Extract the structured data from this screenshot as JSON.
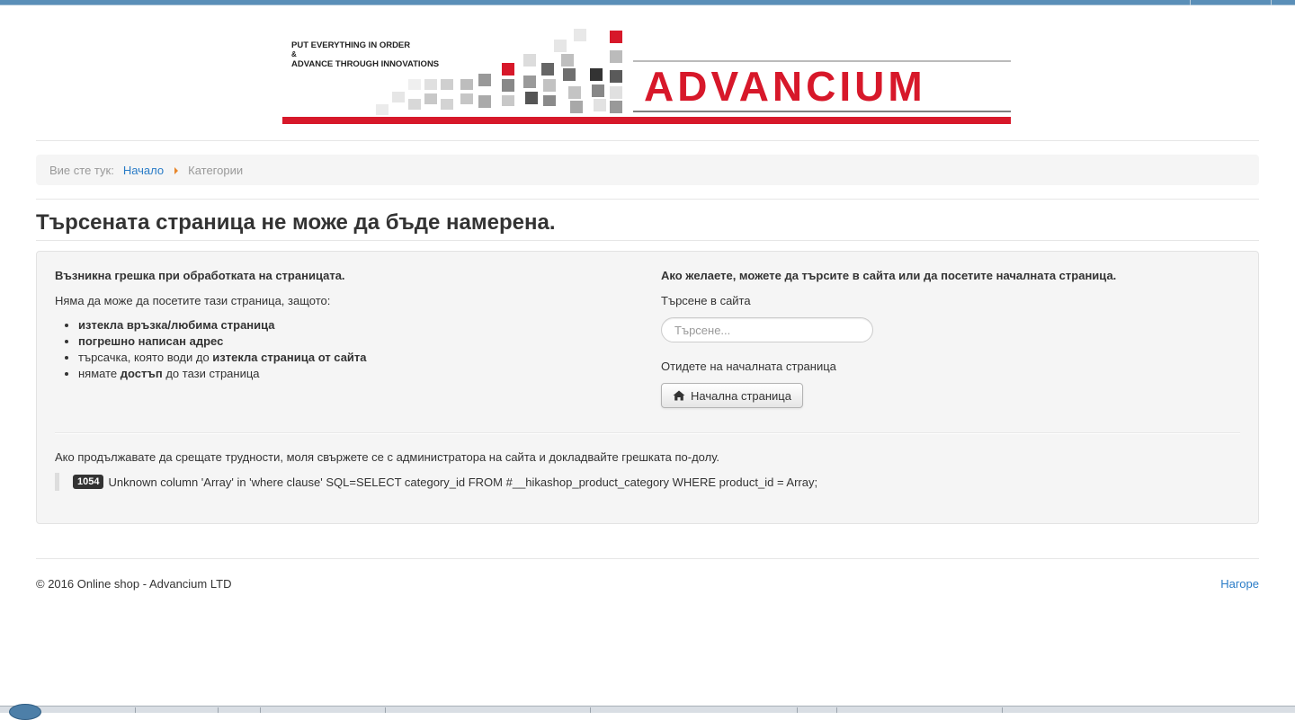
{
  "header": {
    "logo": {
      "tagline_line1": "PUT EVERYTHING IN ORDER",
      "tagline_line2": "&",
      "tagline_line3": "ADVANCE THROUGH INNOVATIONS",
      "brand": "ADVANCIUM",
      "colors": {
        "brand_red": "#d7182a",
        "dark_gray": "#555555"
      }
    }
  },
  "breadcrumb": {
    "prefix": "Вие сте тук:",
    "items": [
      {
        "label": "Начало",
        "link": true
      },
      {
        "label": "Категории",
        "link": false
      }
    ]
  },
  "page_title": "Търсената страница не може да бъде намерена.",
  "error_panel": {
    "left": {
      "heading": "Възникна грешка при обработката на страницата.",
      "intro": "Няма да може да посетите тази страница, защото:",
      "reasons": [
        {
          "parts": [
            {
              "text": "изтекла връзка/любима страница",
              "bold": true
            }
          ]
        },
        {
          "parts": [
            {
              "text": "погрешно написан адрес",
              "bold": true
            }
          ]
        },
        {
          "parts": [
            {
              "text": "търсачка, която води до ",
              "bold": false
            },
            {
              "text": "изтекла страница от сайта",
              "bold": true
            }
          ]
        },
        {
          "parts": [
            {
              "text": "нямате ",
              "bold": false
            },
            {
              "text": "достъп",
              "bold": true
            },
            {
              "text": " до тази страница",
              "bold": false
            }
          ]
        }
      ]
    },
    "right": {
      "heading": "Ако желаете, можете да търсите в сайта или да посетите началната страница.",
      "search_label": "Търсене в сайта",
      "search_placeholder": "Търсене...",
      "search_value": "",
      "home_label": "Отидете на началната страница",
      "home_button": "Начална страница"
    },
    "help_text": "Ако продължавате да срещате трудности, моля свържете се с администратора на сайта и докладвайте грешката по-долу.",
    "error_code": "1054",
    "error_message": "Unknown column 'Array' in 'where clause' SQL=SELECT category_id FROM #__hikashop_product_category WHERE product_id = Array;"
  },
  "footer": {
    "copyright": "© 2016 Online shop - Advancium LTD",
    "back_to_top": "Нагоре"
  },
  "colors": {
    "link": "#2a7cc7",
    "breadcrumb_divider": "#e8872c",
    "well_background": "#f5f5f5",
    "badge_background": "#333333"
  },
  "icons": {
    "home_button_icon": "home-icon",
    "breadcrumb_divider": "caret-right-icon"
  }
}
